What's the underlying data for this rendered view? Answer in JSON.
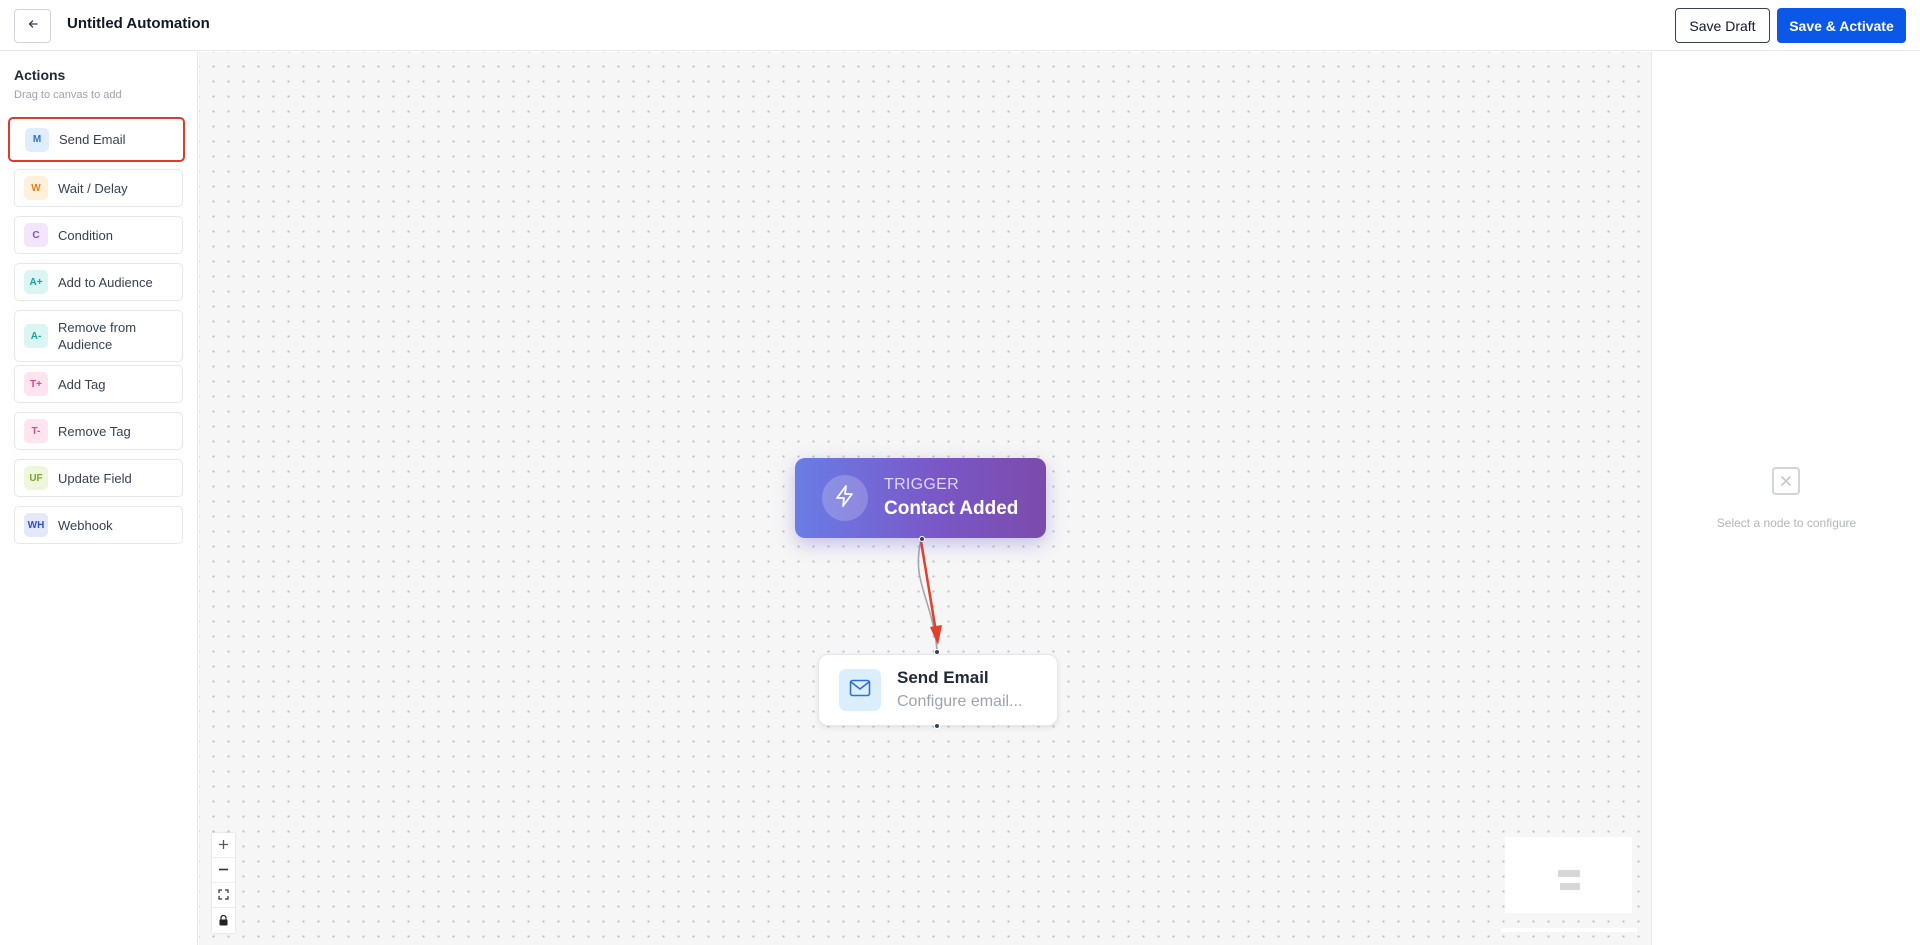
{
  "header": {
    "title": "Untitled Automation",
    "back_icon": "arrow-left-icon",
    "save_draft_label": "Save Draft",
    "save_activate_label": "Save & Activate"
  },
  "sidebar": {
    "title": "Actions",
    "subtitle": "Drag to canvas to add",
    "items": [
      {
        "icon_text": "M",
        "label": "Send Email",
        "icon_color": "#2f6fd6",
        "icon_bg": "#dfeefe"
      },
      {
        "icon_text": "W",
        "label": "Wait / Delay",
        "icon_color": "#d9822b",
        "icon_bg": "#fdf1dc"
      },
      {
        "icon_text": "C",
        "label": "Condition",
        "icon_color": "#8b4fc7",
        "icon_bg": "#f1e6fb"
      },
      {
        "icon_text": "A+",
        "label": "Add to Audience",
        "icon_color": "#1aa39a",
        "icon_bg": "#dbf5f2"
      },
      {
        "icon_text": "A-",
        "label": "Remove from Audience",
        "icon_color": "#1aa39a",
        "icon_bg": "#dbf5f2"
      },
      {
        "icon_text": "T+",
        "label": "Add Tag",
        "icon_color": "#d94b86",
        "icon_bg": "#fde4ee"
      },
      {
        "icon_text": "T-",
        "label": "Remove Tag",
        "icon_color": "#d94b86",
        "icon_bg": "#fde4ee"
      },
      {
        "icon_text": "UF",
        "label": "Update Field",
        "icon_color": "#7aa32a",
        "icon_bg": "#eef7dc"
      },
      {
        "icon_text": "WH",
        "label": "Webhook",
        "icon_color": "#2f4fd6",
        "icon_bg": "#e3e8fb"
      }
    ]
  },
  "canvas": {
    "trigger_node": {
      "kicker": "TRIGGER",
      "title": "Contact Added",
      "icon": "lightning-bolt-icon"
    },
    "action_node": {
      "title": "Send Email",
      "subtitle": "Configure email...",
      "icon": "envelope-icon"
    },
    "zoom_controls": [
      "zoom-in-icon",
      "zoom-out-icon",
      "fit-view-icon",
      "lock-icon"
    ]
  },
  "right_panel": {
    "empty_icon": "close-box-icon",
    "empty_text": "Select a node to configure"
  },
  "colors": {
    "accent": "#0b57e6",
    "highlight": "#dc3b2f",
    "trigger_gradient_start": "#6a7de6",
    "trigger_gradient_end": "#7b4bab",
    "annotation_arrow": "#e2402b"
  }
}
